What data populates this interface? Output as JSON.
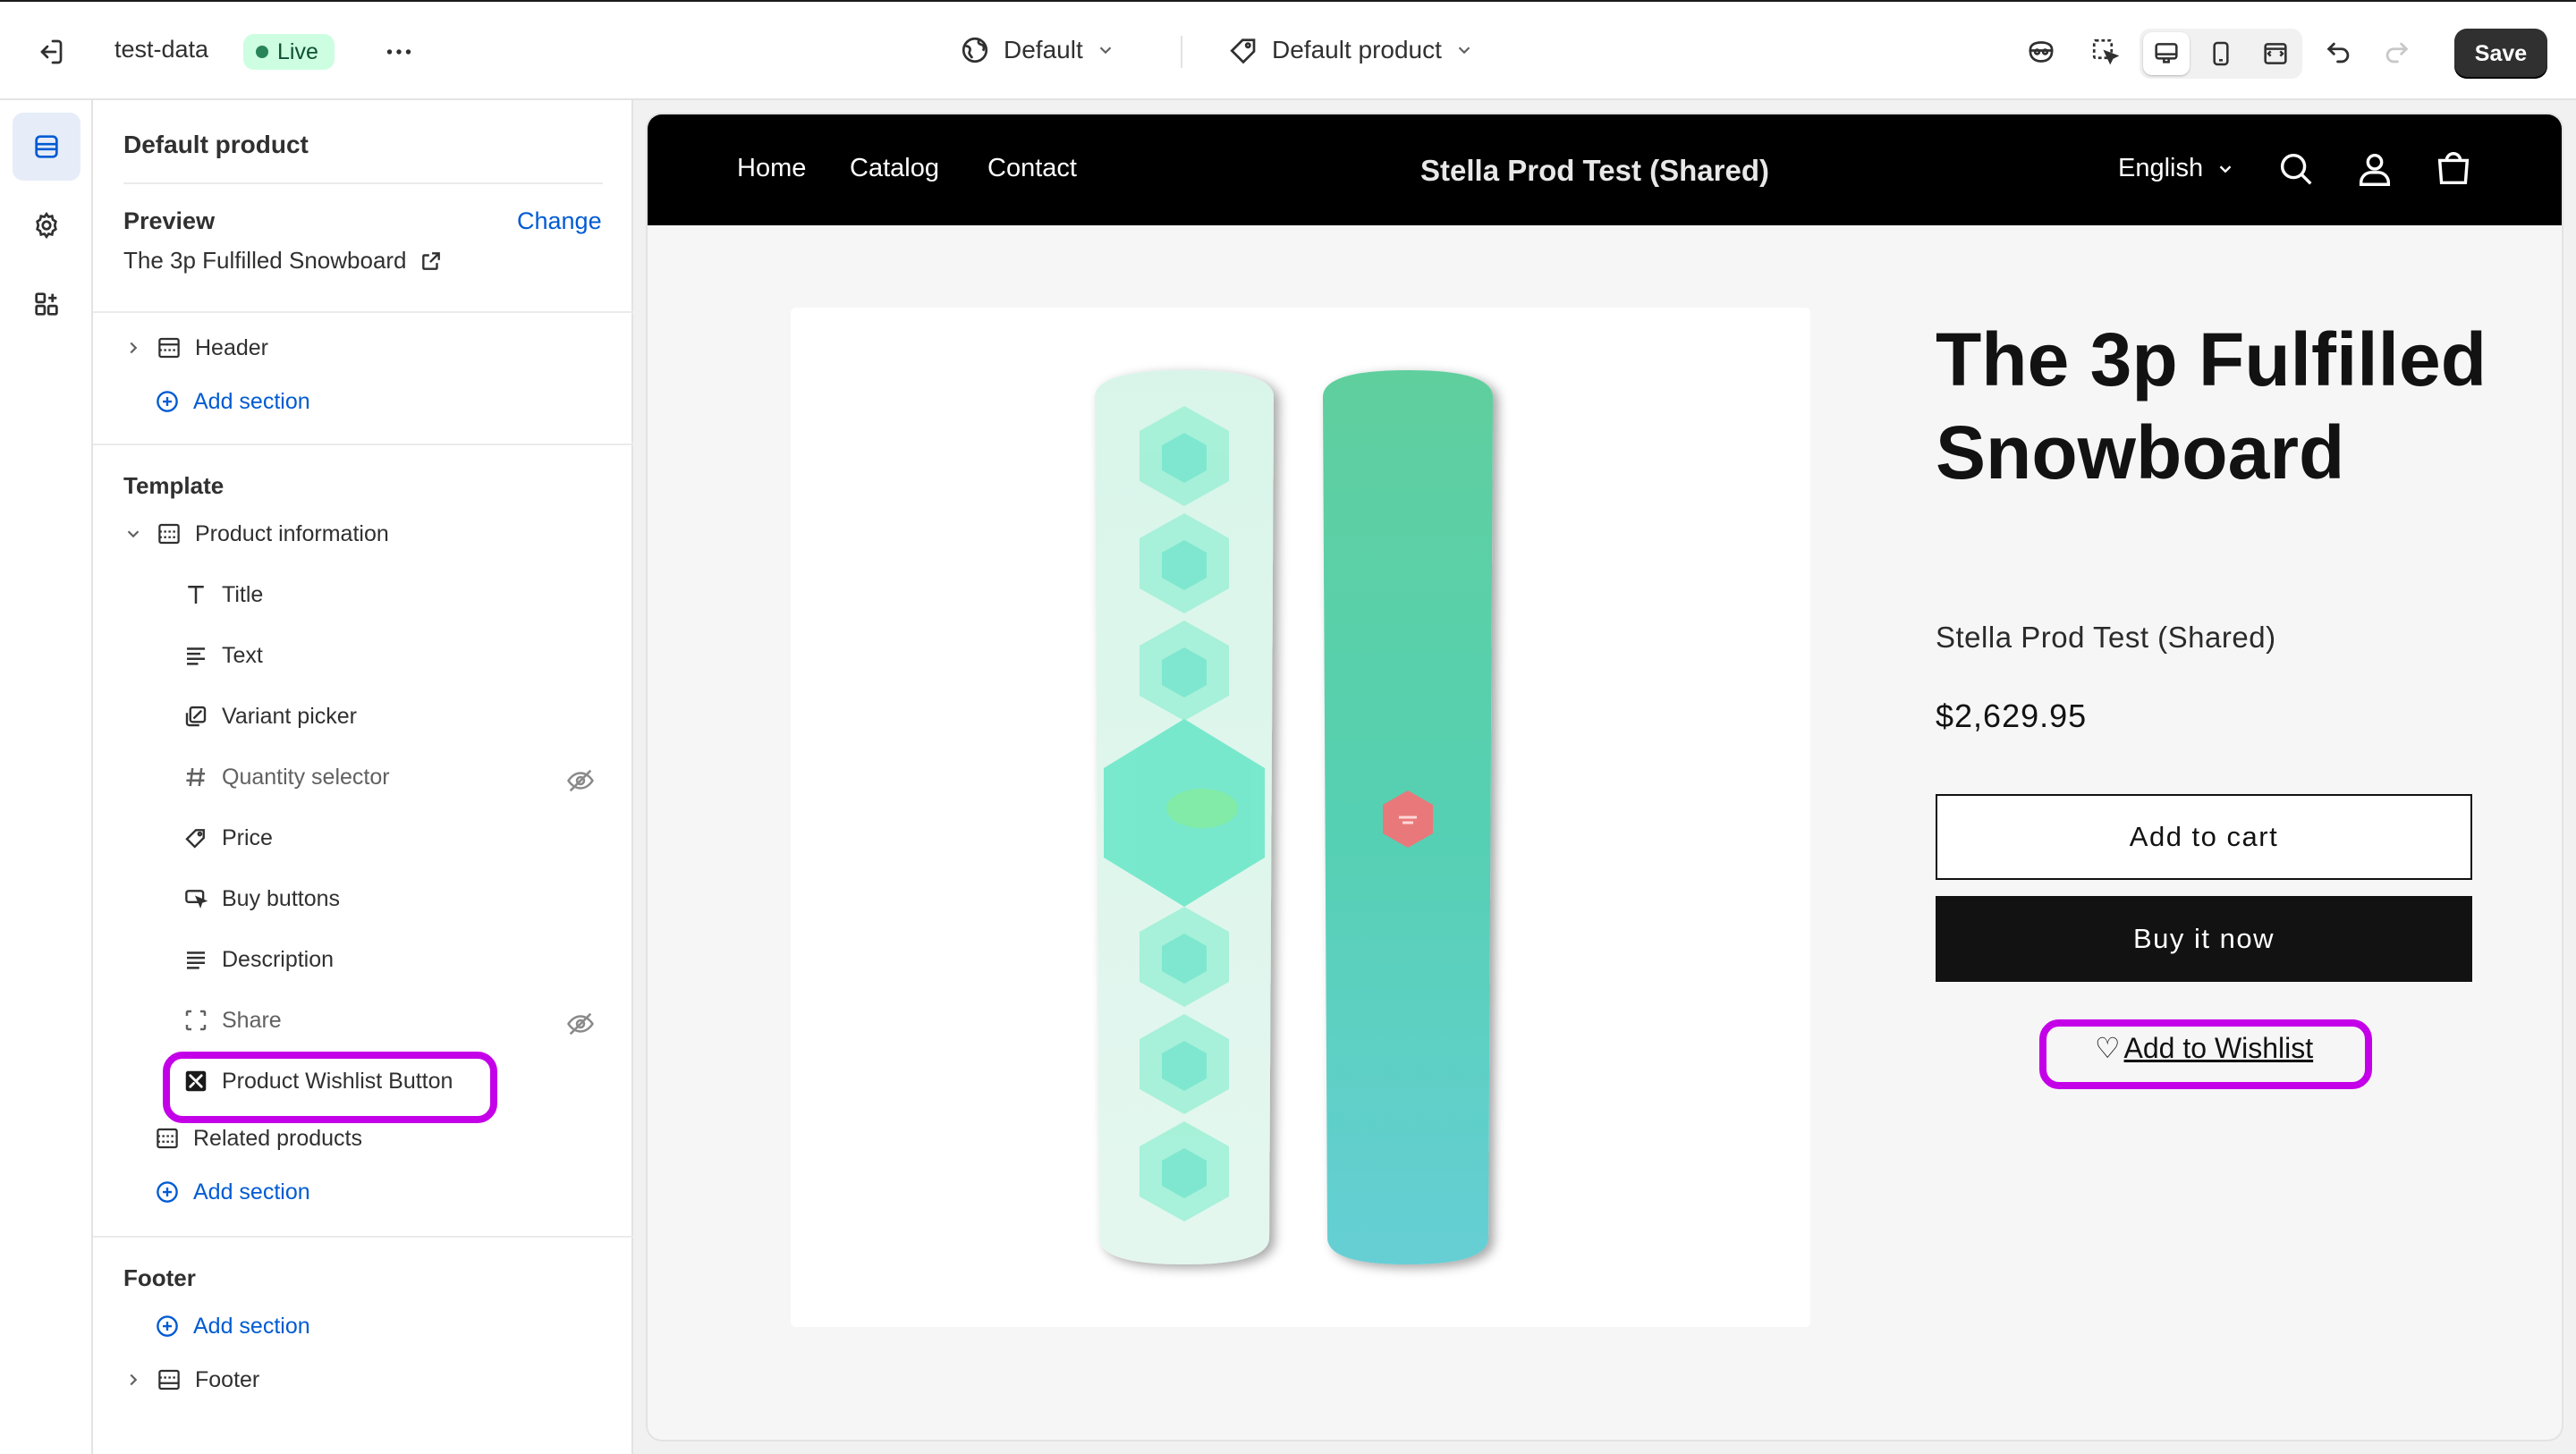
{
  "topbar": {
    "store_name": "test-data",
    "status": "Live",
    "theme_select": "Default",
    "template_select": "Default product",
    "save_label": "Save"
  },
  "sidebar": {
    "title": "Default product",
    "preview_label": "Preview",
    "change_label": "Change",
    "preview_product": "The 3p Fulfilled Snowboard",
    "header_group": "Header",
    "add_section": "Add section",
    "template_label": "Template",
    "product_information": "Product information",
    "blocks": [
      {
        "label": "Title",
        "icon": "title-icon",
        "hidden": false
      },
      {
        "label": "Text",
        "icon": "text-icon",
        "hidden": false
      },
      {
        "label": "Variant picker",
        "icon": "variant-picker-icon",
        "hidden": false
      },
      {
        "label": "Quantity selector",
        "icon": "hash-icon",
        "hidden": true
      },
      {
        "label": "Price",
        "icon": "price-tag-icon",
        "hidden": false
      },
      {
        "label": "Buy buttons",
        "icon": "buy-buttons-icon",
        "hidden": false
      },
      {
        "label": "Description",
        "icon": "description-icon",
        "hidden": false
      },
      {
        "label": "Share",
        "icon": "share-icon",
        "hidden": true
      },
      {
        "label": "Product Wishlist Button",
        "icon": "app-block-icon",
        "hidden": false
      }
    ],
    "related_products": "Related products",
    "footer_label": "Footer",
    "footer_section": "Footer"
  },
  "store": {
    "nav": [
      "Home",
      "Catalog",
      "Contact"
    ],
    "shop_name": "Stella Prod Test (Shared)",
    "language": "English",
    "product": {
      "title": "The 3p Fulfilled Snowboard",
      "vendor": "Stella Prod Test (Shared)",
      "price": "$2,629.95",
      "add_to_cart": "Add to cart",
      "buy_now": "Buy it now",
      "wishlist_heart": "♡",
      "wishlist": "Add to Wishlist"
    }
  },
  "colors": {
    "accent_link": "#005bd3",
    "highlight": "#c400e8",
    "live_badge_bg": "#cdfee1",
    "store_header": "#000000"
  }
}
